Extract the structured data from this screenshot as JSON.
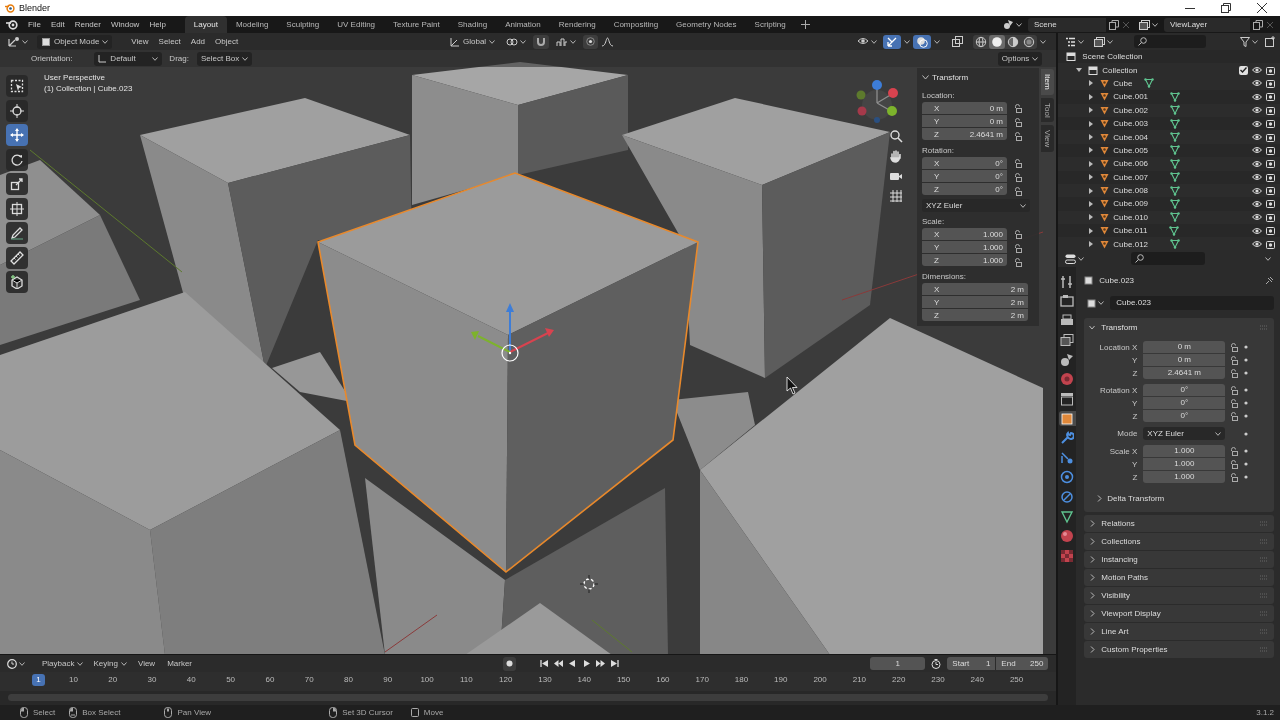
{
  "window": {
    "title": "Blender"
  },
  "menu": [
    "File",
    "Edit",
    "Render",
    "Window",
    "Help"
  ],
  "workspaces": [
    {
      "label": "Layout",
      "selected": true
    },
    {
      "label": "Modeling",
      "selected": false
    },
    {
      "label": "Sculpting",
      "selected": false
    },
    {
      "label": "UV Editing",
      "selected": false
    },
    {
      "label": "Texture Paint",
      "selected": false
    },
    {
      "label": "Shading",
      "selected": false
    },
    {
      "label": "Animation",
      "selected": false
    },
    {
      "label": "Rendering",
      "selected": false
    },
    {
      "label": "Compositing",
      "selected": false
    },
    {
      "label": "Geometry Nodes",
      "selected": false
    },
    {
      "label": "Scripting",
      "selected": false
    }
  ],
  "scene": "Scene",
  "view_layer": "ViewLayer",
  "viewport": {
    "mode": "Object Mode",
    "menus": [
      "View",
      "Select",
      "Add",
      "Object"
    ],
    "transform_orientation": "Global",
    "show_gizmos": true,
    "show_overlays": true,
    "shading_modes": [
      {
        "kind": "wireframe",
        "selected": false
      },
      {
        "kind": "solid",
        "selected": true
      },
      {
        "kind": "material",
        "selected": false
      },
      {
        "kind": "rendered",
        "selected": false
      }
    ],
    "orientation_label": "Orientation:",
    "orientation": "Default",
    "drag_label": "Drag:",
    "drag": "Select Box",
    "options": "Options",
    "view_name": "User Perspective",
    "selection_info": "(1) Collection | Cube.023",
    "tools": [
      {
        "kind": "select-box",
        "selected": false
      },
      {
        "kind": "cursor",
        "selected": false
      },
      {
        "kind": "move",
        "selected": true
      },
      {
        "kind": "rotate",
        "selected": false
      },
      {
        "kind": "scale",
        "selected": false
      },
      {
        "kind": "transform",
        "selected": false
      },
      {
        "kind": "annotate",
        "selected": false
      },
      {
        "kind": "measure",
        "selected": false
      },
      {
        "kind": "add-cube",
        "selected": false
      }
    ],
    "sidebar": {
      "tabs": [
        {
          "label": "Item",
          "selected": true
        },
        {
          "label": "Tool",
          "selected": false
        },
        {
          "label": "View",
          "selected": false
        }
      ],
      "title": "Transform",
      "groups": [
        {
          "kind": "vector",
          "label": "Location:",
          "lockable": true,
          "fields": [
            {
              "axis": "X",
              "value": "0 m"
            },
            {
              "axis": "Y",
              "value": "0 m"
            },
            {
              "axis": "Z",
              "value": "2.4641 m"
            }
          ]
        },
        {
          "kind": "vector",
          "label": "Rotation:",
          "lockable": true,
          "fields": [
            {
              "axis": "X",
              "value": "0°"
            },
            {
              "axis": "Y",
              "value": "0°"
            },
            {
              "axis": "Z",
              "value": "0°"
            }
          ]
        },
        {
          "kind": "dropdown",
          "value": "XYZ Euler"
        },
        {
          "kind": "vector",
          "label": "Scale:",
          "lockable": true,
          "fields": [
            {
              "axis": "X",
              "value": "1.000"
            },
            {
              "axis": "Y",
              "value": "1.000"
            },
            {
              "axis": "Z",
              "value": "1.000"
            }
          ]
        },
        {
          "kind": "vector",
          "label": "Dimensions:",
          "lockable": false,
          "fields": [
            {
              "axis": "X",
              "value": "2 m"
            },
            {
              "axis": "Y",
              "value": "2 m"
            },
            {
              "axis": "Z",
              "value": "2 m"
            }
          ]
        }
      ]
    }
  },
  "outliner": {
    "root": "Scene Collection",
    "collection": {
      "name": "Collection",
      "expanded": true,
      "checked": true,
      "children": [
        {
          "name": "Cube",
          "expanded": false
        },
        {
          "name": "Cube.001",
          "expanded": false
        },
        {
          "name": "Cube.002",
          "expanded": false
        },
        {
          "name": "Cube.003",
          "expanded": false
        },
        {
          "name": "Cube.004",
          "expanded": false
        },
        {
          "name": "Cube.005",
          "expanded": false
        },
        {
          "name": "Cube.006",
          "expanded": false
        },
        {
          "name": "Cube.007",
          "expanded": false
        },
        {
          "name": "Cube.008",
          "expanded": false
        },
        {
          "name": "Cube.009",
          "expanded": false
        },
        {
          "name": "Cube.010",
          "expanded": false
        },
        {
          "name": "Cube.011",
          "expanded": false
        },
        {
          "name": "Cube.012",
          "expanded": false
        }
      ]
    }
  },
  "properties": {
    "tabs": [
      {
        "kind": "tool",
        "selected": false
      },
      {
        "kind": "render",
        "selected": false
      },
      {
        "kind": "output",
        "selected": false
      },
      {
        "kind": "view-layer",
        "selected": false
      },
      {
        "kind": "scene",
        "selected": false
      },
      {
        "kind": "world",
        "selected": false
      },
      {
        "kind": "collection",
        "selected": false
      },
      {
        "kind": "object",
        "selected": true
      },
      {
        "kind": "modifiers",
        "selected": false
      },
      {
        "kind": "particles",
        "selected": false
      },
      {
        "kind": "physics",
        "selected": false
      },
      {
        "kind": "constraints",
        "selected": false
      },
      {
        "kind": "data",
        "selected": false
      },
      {
        "kind": "material",
        "selected": false
      },
      {
        "kind": "texture",
        "selected": false
      }
    ],
    "context": "Cube.023",
    "object_name": "Cube.023",
    "transform": {
      "title": "Transform",
      "expanded": true,
      "groups": [
        {
          "kind": "vector",
          "rows": [
            {
              "label": "Location X",
              "value": "0 m"
            },
            {
              "label": "Y",
              "value": "0 m"
            },
            {
              "label": "Z",
              "value": "2.4641 m"
            }
          ]
        },
        {
          "kind": "vector",
          "rows": [
            {
              "label": "Rotation X",
              "value": "0°"
            },
            {
              "label": "Y",
              "value": "0°"
            },
            {
              "label": "Z",
              "value": "0°"
            }
          ]
        },
        {
          "kind": "dropdown",
          "label": "Mode",
          "value": "XYZ Euler"
        },
        {
          "kind": "vector",
          "rows": [
            {
              "label": "Scale X",
              "value": "1.000"
            },
            {
              "label": "Y",
              "value": "1.000"
            },
            {
              "label": "Z",
              "value": "1.000"
            }
          ]
        }
      ],
      "subpanel": {
        "title": "Delta Transform",
        "expanded": false
      }
    },
    "panels": [
      {
        "title": "Relations",
        "expanded": false
      },
      {
        "title": "Collections",
        "expanded": false
      },
      {
        "title": "Instancing",
        "expanded": false
      },
      {
        "title": "Motion Paths",
        "expanded": false
      },
      {
        "title": "Visibility",
        "expanded": false
      },
      {
        "title": "Viewport Display",
        "expanded": false
      },
      {
        "title": "Line Art",
        "expanded": false
      },
      {
        "title": "Custom Properties",
        "expanded": false
      }
    ]
  },
  "timeline": {
    "menus": [
      {
        "label": "Playback",
        "kind": "dropdown"
      },
      {
        "label": "Keying",
        "kind": "dropdown"
      },
      {
        "label": "View",
        "kind": "menu"
      },
      {
        "label": "Marker",
        "kind": "menu"
      }
    ],
    "current_frame": "1",
    "start_label": "Start",
    "start": "1",
    "end_label": "End",
    "end": "250",
    "playhead": "1",
    "ticks": [
      "10",
      "20",
      "30",
      "40",
      "50",
      "60",
      "70",
      "80",
      "90",
      "100",
      "110",
      "120",
      "130",
      "140",
      "150",
      "160",
      "170",
      "180",
      "190",
      "200",
      "210",
      "220",
      "230",
      "240",
      "250"
    ]
  },
  "status_bar": {
    "items": [
      {
        "kind": "mouse-left",
        "label": "Select"
      },
      {
        "kind": "mouse-drag",
        "label": "Box Select"
      },
      {
        "kind": "mouse-middle",
        "label": "Pan View"
      },
      {
        "kind": "mouse-right",
        "label": "Set 3D Cursor"
      },
      {
        "kind": "key",
        "label": "Move"
      }
    ],
    "version": "3.1.2"
  }
}
